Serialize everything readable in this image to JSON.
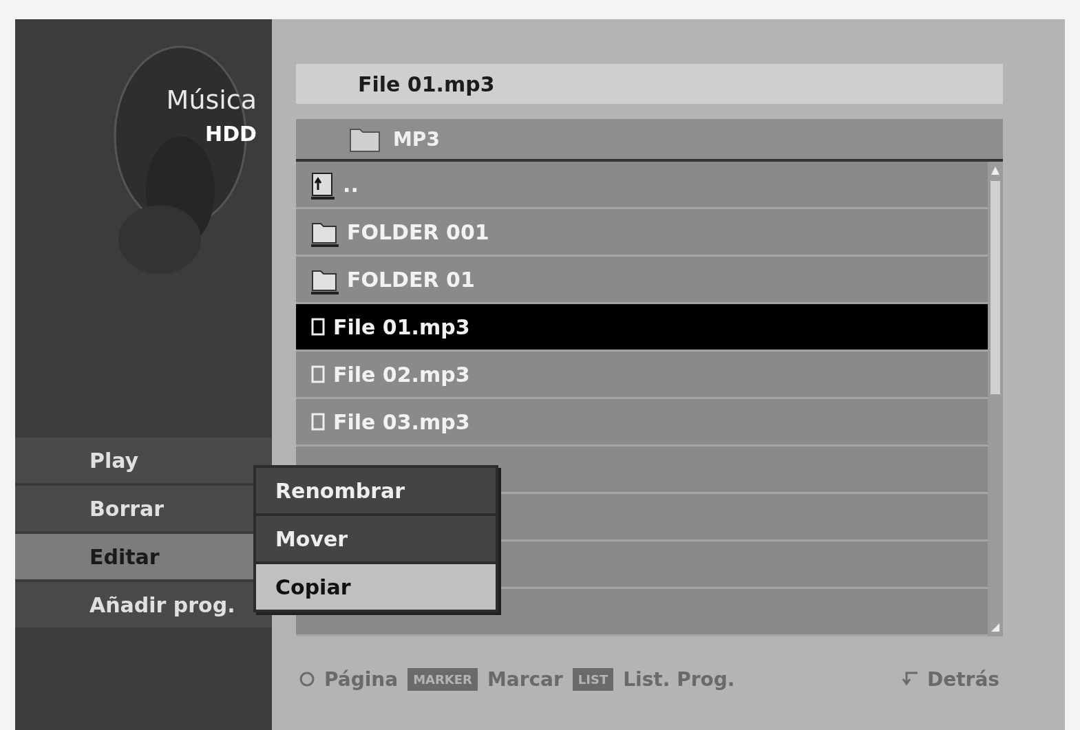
{
  "sidebar": {
    "title": "Música",
    "source": "HDD",
    "menu": [
      {
        "label": "Play",
        "selected": false
      },
      {
        "label": "Borrar",
        "selected": false
      },
      {
        "label": "Editar",
        "selected": true
      },
      {
        "label": "Añadir prog.",
        "selected": false
      }
    ]
  },
  "submenu": [
    {
      "label": "Renombrar",
      "selected": false
    },
    {
      "label": "Mover",
      "selected": false
    },
    {
      "label": "Copiar",
      "selected": true
    }
  ],
  "header": {
    "title": "File 01.mp3"
  },
  "path": {
    "label": "MP3"
  },
  "list": [
    {
      "kind": "parent",
      "label": "..",
      "selected": false
    },
    {
      "kind": "folder",
      "label": "FOLDER 001",
      "selected": false
    },
    {
      "kind": "folder",
      "label": "FOLDER 01",
      "selected": false
    },
    {
      "kind": "file",
      "label": "File 01.mp3",
      "selected": true
    },
    {
      "kind": "file",
      "label": "File 02.mp3",
      "selected": false
    },
    {
      "kind": "file",
      "label": "File 03.mp3",
      "selected": false
    },
    {
      "kind": "empty",
      "selected": false
    },
    {
      "kind": "empty",
      "selected": false
    },
    {
      "kind": "empty",
      "selected": false
    },
    {
      "kind": "empty",
      "selected": false
    }
  ],
  "footer": {
    "hints": [
      {
        "label": "Página"
      },
      {
        "key": "MARKER",
        "label": "Marcar"
      },
      {
        "key": "LIST",
        "label": "List. Prog."
      }
    ],
    "back": "Detrás"
  }
}
